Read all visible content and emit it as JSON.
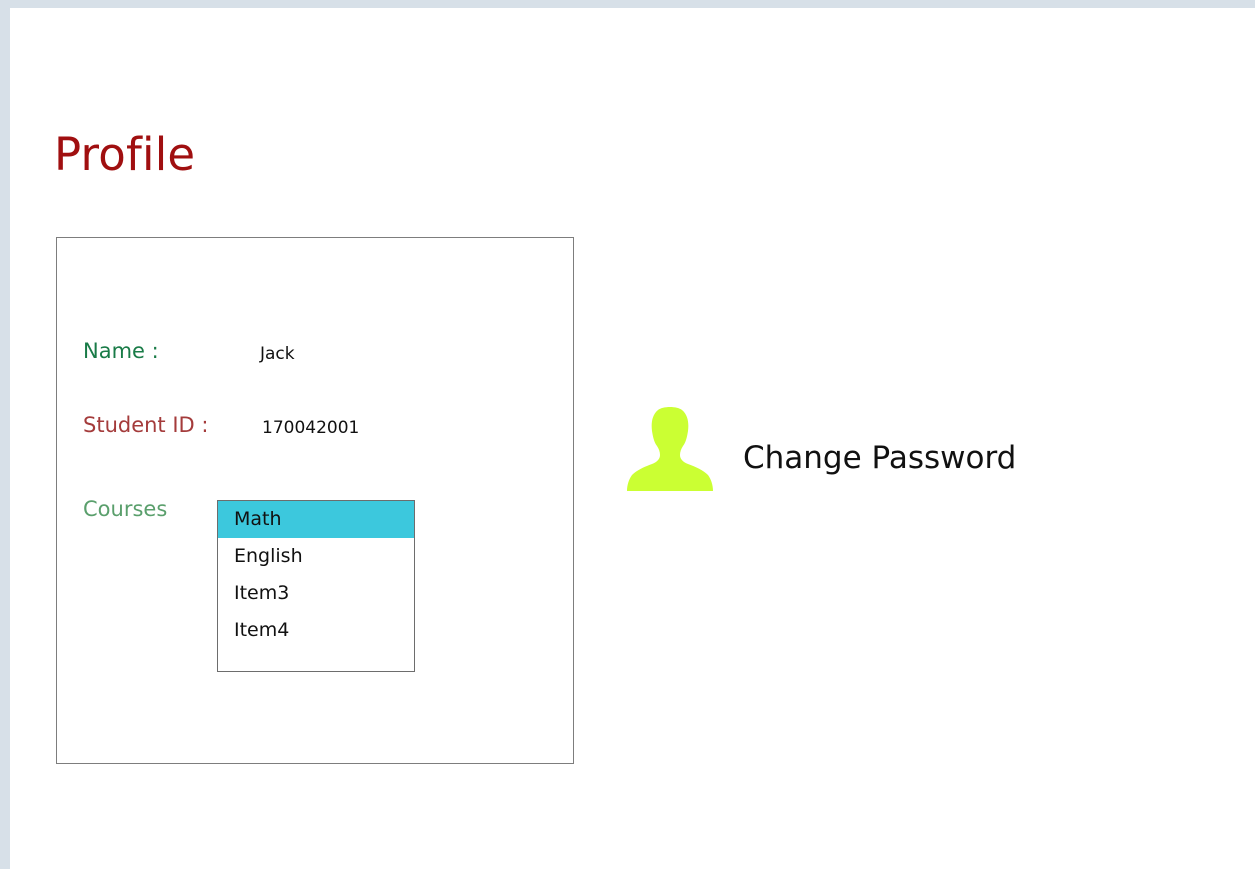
{
  "page": {
    "title": "Profile"
  },
  "profile": {
    "name_label": "Name :",
    "name_value": "Jack",
    "student_id_label": "Student ID :",
    "student_id_value": "170042001",
    "courses_label": "Courses",
    "courses": [
      {
        "label": "Math",
        "selected": true
      },
      {
        "label": "English",
        "selected": false
      },
      {
        "label": "Item3",
        "selected": false
      },
      {
        "label": "Item4",
        "selected": false
      }
    ]
  },
  "actions": {
    "change_password_label": "Change Password",
    "change_password_icon": "user-icon"
  },
  "colors": {
    "title": "#a00f10",
    "name_label": "#197b47",
    "student_id_label": "#a43b3b",
    "courses_label": "#5a9f6c",
    "selection": "#3cc8dd",
    "user_icon": "#cbff33"
  }
}
